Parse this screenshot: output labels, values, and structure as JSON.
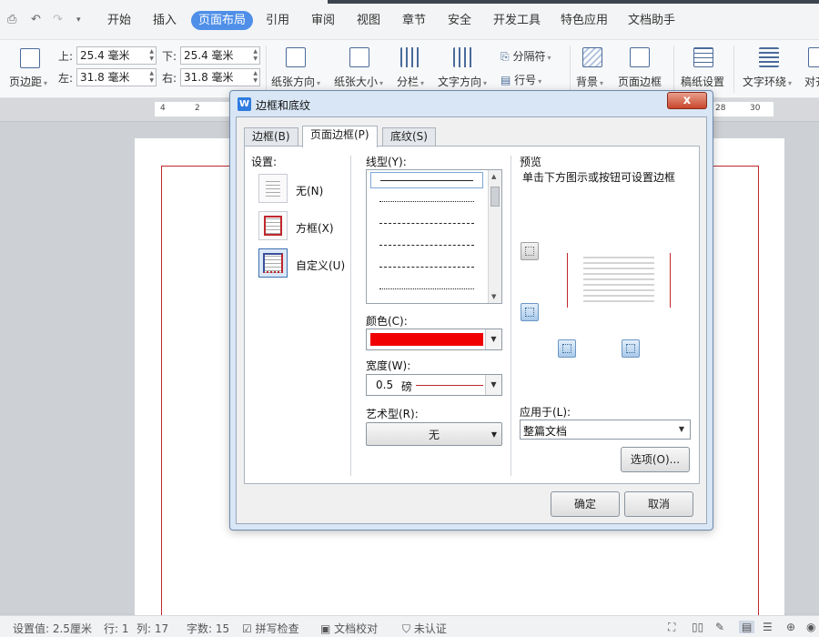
{
  "menubar": {
    "tabs": [
      "开始",
      "插入",
      "页面布局",
      "引用",
      "审阅",
      "视图",
      "章节",
      "安全",
      "开发工具",
      "特色应用",
      "文档助手"
    ],
    "active_tab": "页面布局"
  },
  "ribbon": {
    "margins_label": "页边距",
    "top_label": "上:",
    "top_value": "25.4 毫米",
    "bottom_label": "下:",
    "bottom_value": "25.4 毫米",
    "left_label": "左:",
    "left_value": "31.8 毫米",
    "right_label": "右:",
    "right_value": "31.8 毫米",
    "orientation_label": "纸张方向",
    "size_label": "纸张大小",
    "columns_label": "分栏",
    "text_direction_label": "文字方向",
    "separator_label": "分隔符",
    "line_number_label": "行号",
    "background_label": "背景",
    "page_border_label": "页面边框",
    "manuscript_label": "稿纸设置",
    "text_wrap_label": "文字环绕",
    "align_label": "对齐"
  },
  "ruler": {
    "ticks_left": [
      "4",
      "2"
    ],
    "ticks_right": [
      "28",
      "30"
    ]
  },
  "dialog": {
    "title": "边框和底纹",
    "close_symbol": "x",
    "tabs": [
      "边框(B)",
      "页面边框(P)",
      "底纹(S)"
    ],
    "active_tab": "页面边框(P)",
    "settings_label": "设置:",
    "settings": [
      "无(N)",
      "方框(X)",
      "自定义(U)"
    ],
    "selected_setting": "自定义(U)",
    "line_style_label": "线型(Y):",
    "color_label": "颜色(C):",
    "color_value": "#f00000",
    "width_label": "宽度(W):",
    "width_value": "0.5",
    "width_unit": "磅",
    "art_label": "艺术型(R):",
    "art_value": "无",
    "preview_label": "预览",
    "preview_hint": "单击下方图示或按钮可设置边框",
    "apply_label": "应用于(L):",
    "apply_value": "整篇文档",
    "options_button": "选项(O)...",
    "ok_button": "确定",
    "cancel_button": "取消"
  },
  "statusbar": {
    "setting_value": "设置值: 2.5厘米",
    "row": "行: 1",
    "col": "列: 17",
    "word_count": "字数: 15",
    "spell_check": "拼写检查",
    "doc_proof": "文档校对",
    "certification": "未认证"
  },
  "colors": {
    "accent": "#4f8fe8",
    "page_border": "#c0272d",
    "dialog_bg": "#d8e6f5"
  }
}
